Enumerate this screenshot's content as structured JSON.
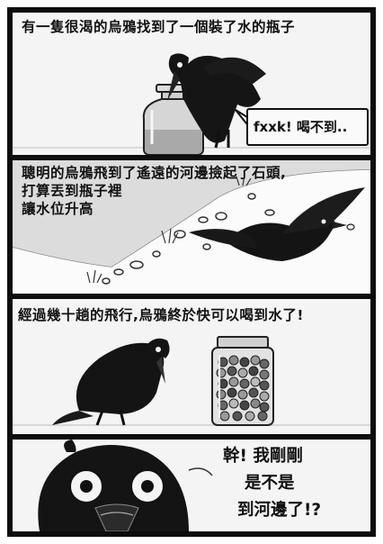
{
  "panels": [
    {
      "caption_lines": [
        "有一隻很渴的烏鴉找到了一個裝了水的瓶子"
      ],
      "speech": "fxxk! 喝不到.."
    },
    {
      "caption_lines": [
        "聰明的烏鴉飛到了遙遠的河邊撿起了石頭,",
        "打算丟到瓶子裡",
        "讓水位升高"
      ]
    },
    {
      "caption_lines": [
        "經過幾十趟的飛行,烏鴉終於快可以喝到水了!"
      ]
    },
    {
      "speech_lines": [
        "幹! 我剛剛",
        "是不是",
        "到河邊了!?"
      ]
    }
  ],
  "colors": {
    "ink": "#111111",
    "panel_bg": "#f4f4f4",
    "border": "#0d0d0d"
  }
}
